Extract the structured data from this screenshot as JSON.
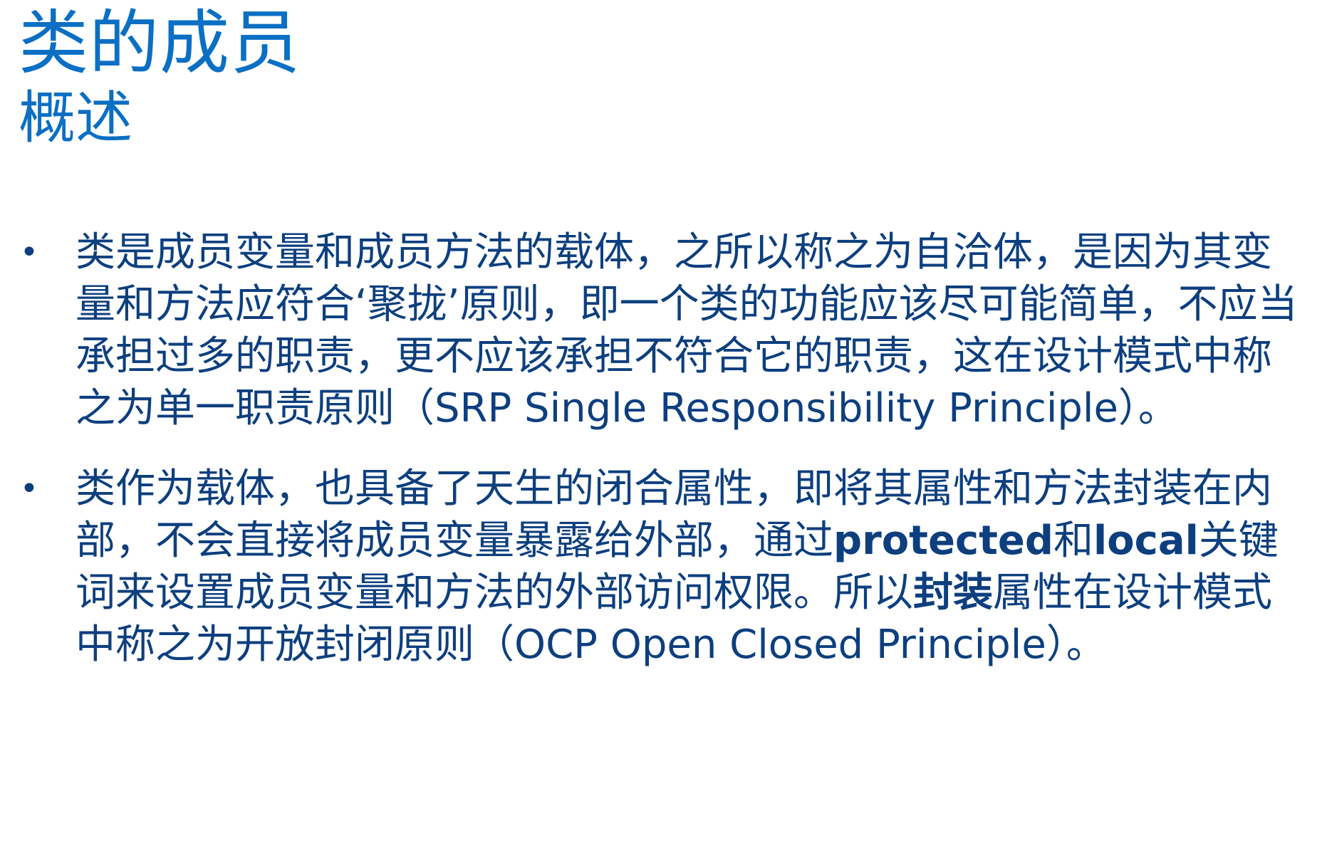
{
  "slide": {
    "title": "类的成员",
    "subtitle": "概述",
    "bullet_symbol": "•",
    "bullets": [
      {
        "text": "类是成员变量和成员方法的载体，之所以称之为自洽体，是因为其变量和方法应符合‘聚拢’原则，即一个类的功能应该尽可能简单，不应当承担过多的职责，更不应该承担不符合它的职责，这在设计模式中称之为单一职责原则（SRP Single Responsibility Principle）。"
      },
      {
        "part1": "类作为载体，也具备了天生的闭合属性，即将其属性和方法封装在内部，不会直接将成员变量暴露给外部，通过",
        "bold1": "protected",
        "part2": "和",
        "bold2": "local",
        "part3": "关键词来设置成员变量和方法的外部访问权限。所以",
        "bold3": "封装",
        "part4": "属性在设计模式中称之为开放封闭原则（OCP Open Closed Principle）。"
      }
    ]
  },
  "colors": {
    "title": "#0b6fc4",
    "body_text": "#0d3f7f",
    "background": "#ffffff"
  }
}
